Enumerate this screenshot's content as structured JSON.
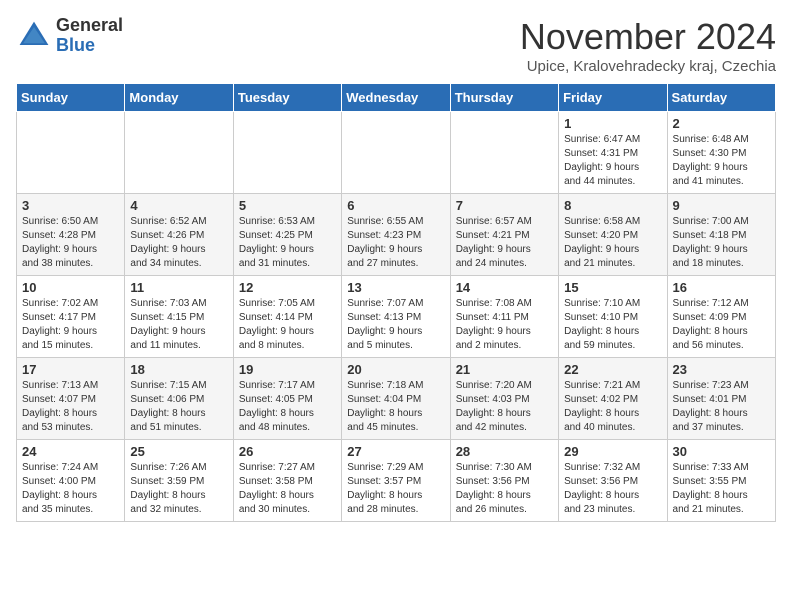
{
  "logo": {
    "general": "General",
    "blue": "Blue"
  },
  "title": "November 2024",
  "location": "Upice, Kralovehradecky kraj, Czechia",
  "days_of_week": [
    "Sunday",
    "Monday",
    "Tuesday",
    "Wednesday",
    "Thursday",
    "Friday",
    "Saturday"
  ],
  "weeks": [
    [
      {
        "day": "",
        "info": ""
      },
      {
        "day": "",
        "info": ""
      },
      {
        "day": "",
        "info": ""
      },
      {
        "day": "",
        "info": ""
      },
      {
        "day": "",
        "info": ""
      },
      {
        "day": "1",
        "info": "Sunrise: 6:47 AM\nSunset: 4:31 PM\nDaylight: 9 hours\nand 44 minutes."
      },
      {
        "day": "2",
        "info": "Sunrise: 6:48 AM\nSunset: 4:30 PM\nDaylight: 9 hours\nand 41 minutes."
      }
    ],
    [
      {
        "day": "3",
        "info": "Sunrise: 6:50 AM\nSunset: 4:28 PM\nDaylight: 9 hours\nand 38 minutes."
      },
      {
        "day": "4",
        "info": "Sunrise: 6:52 AM\nSunset: 4:26 PM\nDaylight: 9 hours\nand 34 minutes."
      },
      {
        "day": "5",
        "info": "Sunrise: 6:53 AM\nSunset: 4:25 PM\nDaylight: 9 hours\nand 31 minutes."
      },
      {
        "day": "6",
        "info": "Sunrise: 6:55 AM\nSunset: 4:23 PM\nDaylight: 9 hours\nand 27 minutes."
      },
      {
        "day": "7",
        "info": "Sunrise: 6:57 AM\nSunset: 4:21 PM\nDaylight: 9 hours\nand 24 minutes."
      },
      {
        "day": "8",
        "info": "Sunrise: 6:58 AM\nSunset: 4:20 PM\nDaylight: 9 hours\nand 21 minutes."
      },
      {
        "day": "9",
        "info": "Sunrise: 7:00 AM\nSunset: 4:18 PM\nDaylight: 9 hours\nand 18 minutes."
      }
    ],
    [
      {
        "day": "10",
        "info": "Sunrise: 7:02 AM\nSunset: 4:17 PM\nDaylight: 9 hours\nand 15 minutes."
      },
      {
        "day": "11",
        "info": "Sunrise: 7:03 AM\nSunset: 4:15 PM\nDaylight: 9 hours\nand 11 minutes."
      },
      {
        "day": "12",
        "info": "Sunrise: 7:05 AM\nSunset: 4:14 PM\nDaylight: 9 hours\nand 8 minutes."
      },
      {
        "day": "13",
        "info": "Sunrise: 7:07 AM\nSunset: 4:13 PM\nDaylight: 9 hours\nand 5 minutes."
      },
      {
        "day": "14",
        "info": "Sunrise: 7:08 AM\nSunset: 4:11 PM\nDaylight: 9 hours\nand 2 minutes."
      },
      {
        "day": "15",
        "info": "Sunrise: 7:10 AM\nSunset: 4:10 PM\nDaylight: 8 hours\nand 59 minutes."
      },
      {
        "day": "16",
        "info": "Sunrise: 7:12 AM\nSunset: 4:09 PM\nDaylight: 8 hours\nand 56 minutes."
      }
    ],
    [
      {
        "day": "17",
        "info": "Sunrise: 7:13 AM\nSunset: 4:07 PM\nDaylight: 8 hours\nand 53 minutes."
      },
      {
        "day": "18",
        "info": "Sunrise: 7:15 AM\nSunset: 4:06 PM\nDaylight: 8 hours\nand 51 minutes."
      },
      {
        "day": "19",
        "info": "Sunrise: 7:17 AM\nSunset: 4:05 PM\nDaylight: 8 hours\nand 48 minutes."
      },
      {
        "day": "20",
        "info": "Sunrise: 7:18 AM\nSunset: 4:04 PM\nDaylight: 8 hours\nand 45 minutes."
      },
      {
        "day": "21",
        "info": "Sunrise: 7:20 AM\nSunset: 4:03 PM\nDaylight: 8 hours\nand 42 minutes."
      },
      {
        "day": "22",
        "info": "Sunrise: 7:21 AM\nSunset: 4:02 PM\nDaylight: 8 hours\nand 40 minutes."
      },
      {
        "day": "23",
        "info": "Sunrise: 7:23 AM\nSunset: 4:01 PM\nDaylight: 8 hours\nand 37 minutes."
      }
    ],
    [
      {
        "day": "24",
        "info": "Sunrise: 7:24 AM\nSunset: 4:00 PM\nDaylight: 8 hours\nand 35 minutes."
      },
      {
        "day": "25",
        "info": "Sunrise: 7:26 AM\nSunset: 3:59 PM\nDaylight: 8 hours\nand 32 minutes."
      },
      {
        "day": "26",
        "info": "Sunrise: 7:27 AM\nSunset: 3:58 PM\nDaylight: 8 hours\nand 30 minutes."
      },
      {
        "day": "27",
        "info": "Sunrise: 7:29 AM\nSunset: 3:57 PM\nDaylight: 8 hours\nand 28 minutes."
      },
      {
        "day": "28",
        "info": "Sunrise: 7:30 AM\nSunset: 3:56 PM\nDaylight: 8 hours\nand 26 minutes."
      },
      {
        "day": "29",
        "info": "Sunrise: 7:32 AM\nSunset: 3:56 PM\nDaylight: 8 hours\nand 23 minutes."
      },
      {
        "day": "30",
        "info": "Sunrise: 7:33 AM\nSunset: 3:55 PM\nDaylight: 8 hours\nand 21 minutes."
      }
    ]
  ]
}
